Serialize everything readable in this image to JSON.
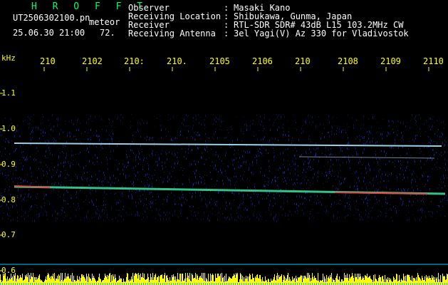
{
  "header": {
    "app_name": "H R O F F T",
    "filename": "UT2506302100.pn",
    "mode": "meteor",
    "timestamp": "25.06.30 21:00",
    "gain_value": "72.",
    "observer_label": "Observer",
    "observer_value": "Masaki Kano",
    "location_label": "Receiving Location",
    "location_value": "Shibukawa, Gunma, Japan",
    "receiver_label": "Receiver",
    "receiver_value": "RTL-SDR SDR# 43dB L15 103.2MHz CW",
    "antenna_label": "Receiving Antenna",
    "antenna_value": "3el Yagi(V) Az 330 for Vladivostok",
    "separator": ":"
  },
  "axis": {
    "unit": "kHz",
    "y_ticks": [
      "1.1",
      "1.0",
      "0.9",
      "0.8",
      "0.7",
      "0.6"
    ],
    "x_ticks": [
      "210",
      "2102",
      "210:",
      "210.",
      "2105",
      "2106",
      "210",
      "2108",
      "2109",
      "2110"
    ]
  },
  "colors": {
    "background": "#000000",
    "tick_label": "#ffff00",
    "header_text": "#ffffff",
    "app_name": "#00ff66",
    "signal_line": "#aee6ff",
    "echo_band": "#39e6a0",
    "hot_echo": "#ff3b3b",
    "noise": "#1f3cff",
    "amplitude_bars": "#ffff00",
    "amplitude_baseline": "#00c8ff"
  }
}
